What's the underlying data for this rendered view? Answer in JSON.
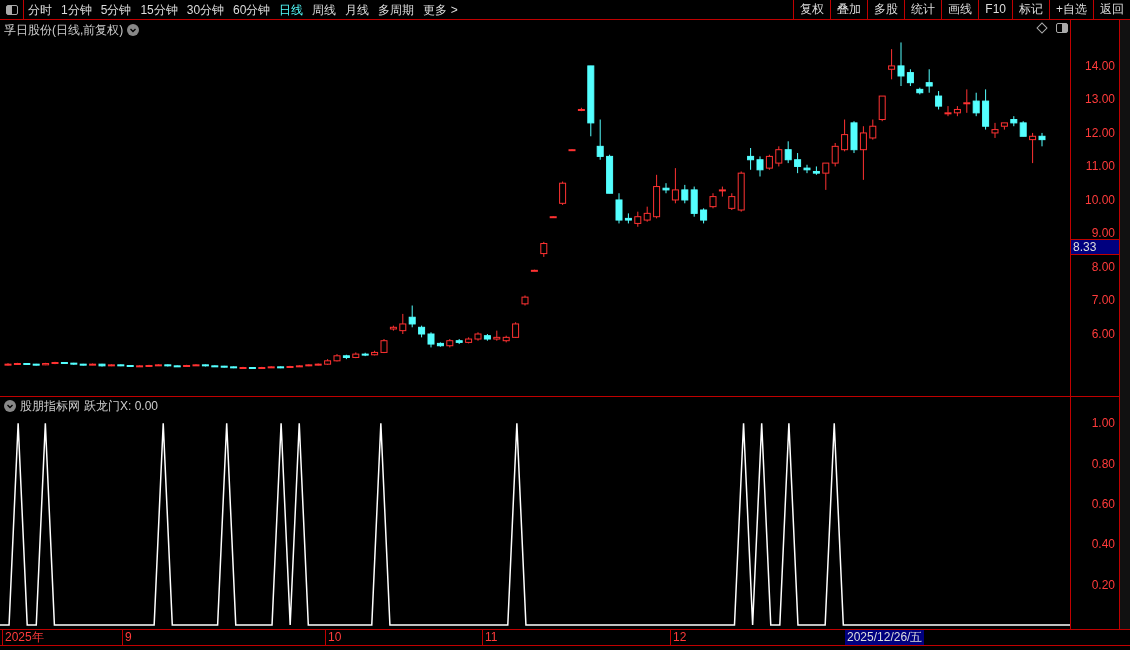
{
  "toolbar": {
    "periods": [
      {
        "label": "分时",
        "selected": false
      },
      {
        "label": "1分钟",
        "selected": false
      },
      {
        "label": "5分钟",
        "selected": false
      },
      {
        "label": "15分钟",
        "selected": false
      },
      {
        "label": "30分钟",
        "selected": false
      },
      {
        "label": "60分钟",
        "selected": false
      },
      {
        "label": "日线",
        "selected": true
      },
      {
        "label": "周线",
        "selected": false
      },
      {
        "label": "月线",
        "selected": false
      },
      {
        "label": "多周期",
        "selected": false
      },
      {
        "label": "更多 >",
        "selected": false
      }
    ],
    "actions": [
      "复权",
      "叠加",
      "多股",
      "统计",
      "画线",
      "F10",
      "标记",
      "+自选",
      "返回"
    ]
  },
  "main_chart": {
    "title": "孚日股份(日线,前复权)",
    "current_price": "8.33",
    "chart_data": {
      "type": "candlestick",
      "ylim": [
        4.15,
        15.37
      ],
      "yticks": [
        {
          "value": 14,
          "label": "14.00"
        },
        {
          "value": 13,
          "label": "13.00"
        },
        {
          "value": 12,
          "label": "12.00"
        },
        {
          "value": 11,
          "label": "11.00"
        },
        {
          "value": 10,
          "label": "10.00"
        },
        {
          "value": 9,
          "label": "9.00"
        },
        {
          "value": 8,
          "label": "8.00"
        },
        {
          "value": 7,
          "label": "7.00"
        },
        {
          "value": 6,
          "label": "6.00"
        }
      ],
      "ohlc": [
        [
          5.08,
          5.13,
          5.06,
          5.1
        ],
        [
          5.1,
          5.14,
          5.08,
          5.12
        ],
        [
          5.12,
          5.13,
          5.08,
          5.1
        ],
        [
          5.1,
          5.11,
          5.06,
          5.08
        ],
        [
          5.08,
          5.14,
          5.07,
          5.12
        ],
        [
          5.12,
          5.17,
          5.1,
          5.15
        ],
        [
          5.15,
          5.16,
          5.11,
          5.13
        ],
        [
          5.13,
          5.14,
          5.08,
          5.1
        ],
        [
          5.1,
          5.11,
          5.06,
          5.08
        ],
        [
          5.08,
          5.12,
          5.07,
          5.1
        ],
        [
          5.1,
          5.11,
          5.03,
          5.05
        ],
        [
          5.05,
          5.1,
          5.04,
          5.08
        ],
        [
          5.08,
          5.09,
          5.04,
          5.06
        ],
        [
          5.06,
          5.07,
          5.02,
          5.04
        ],
        [
          5.04,
          5.07,
          5.03,
          5.05
        ],
        [
          5.05,
          5.08,
          5.04,
          5.06
        ],
        [
          5.06,
          5.1,
          5.05,
          5.08
        ],
        [
          5.08,
          5.09,
          5.03,
          5.05
        ],
        [
          5.05,
          5.06,
          5.02,
          5.04
        ],
        [
          5.04,
          5.08,
          5.03,
          5.06
        ],
        [
          5.06,
          5.1,
          5.05,
          5.08
        ],
        [
          5.08,
          5.09,
          5.03,
          5.05
        ],
        [
          5.05,
          5.06,
          5.02,
          5.04
        ],
        [
          5.04,
          5.05,
          5.0,
          5.02
        ],
        [
          5.02,
          5.03,
          4.98,
          5.0
        ],
        [
          5.0,
          5.02,
          4.98,
          5.0
        ],
        [
          5.0,
          5.01,
          4.96,
          4.98
        ],
        [
          4.98,
          5.02,
          4.97,
          5.0
        ],
        [
          5.0,
          5.04,
          4.99,
          5.02
        ],
        [
          5.02,
          5.03,
          4.98,
          5.0
        ],
        [
          5.0,
          5.05,
          4.99,
          5.03
        ],
        [
          5.03,
          5.07,
          5.02,
          5.05
        ],
        [
          5.05,
          5.1,
          5.04,
          5.08
        ],
        [
          5.08,
          5.12,
          5.06,
          5.1
        ],
        [
          5.1,
          5.25,
          5.08,
          5.2
        ],
        [
          5.2,
          5.4,
          5.18,
          5.35
        ],
        [
          5.35,
          5.38,
          5.25,
          5.3
        ],
        [
          5.3,
          5.45,
          5.28,
          5.4
        ],
        [
          5.4,
          5.44,
          5.34,
          5.38
        ],
        [
          5.38,
          5.5,
          5.36,
          5.45
        ],
        [
          5.45,
          5.85,
          5.43,
          5.8
        ],
        [
          6.15,
          6.25,
          6.1,
          6.2
        ],
        [
          6.1,
          6.6,
          6.0,
          6.3
        ],
        [
          6.5,
          6.85,
          6.2,
          6.3
        ],
        [
          6.2,
          6.25,
          5.9,
          6.0
        ],
        [
          6.0,
          6.05,
          5.6,
          5.7
        ],
        [
          5.72,
          5.75,
          5.62,
          5.65
        ],
        [
          5.65,
          5.85,
          5.6,
          5.8
        ],
        [
          5.8,
          5.85,
          5.7,
          5.75
        ],
        [
          5.75,
          5.9,
          5.72,
          5.85
        ],
        [
          5.85,
          6.05,
          5.8,
          6.0
        ],
        [
          5.95,
          6.0,
          5.8,
          5.85
        ],
        [
          5.85,
          6.1,
          5.8,
          5.9
        ],
        [
          5.8,
          5.95,
          5.75,
          5.9
        ],
        [
          5.9,
          6.35,
          5.88,
          6.3
        ],
        [
          6.9,
          7.15,
          6.85,
          7.1
        ],
        [
          7.9,
          7.92,
          7.88,
          7.9
        ],
        [
          8.4,
          8.75,
          8.3,
          8.7
        ],
        [
          9.5,
          9.52,
          9.48,
          9.5
        ],
        [
          9.9,
          10.55,
          9.85,
          10.5
        ],
        [
          11.5,
          11.52,
          11.48,
          11.5
        ],
        [
          12.7,
          12.75,
          12.65,
          12.7
        ],
        [
          14.0,
          14.0,
          11.9,
          12.3
        ],
        [
          11.6,
          12.4,
          11.2,
          11.3
        ],
        [
          11.3,
          11.35,
          10.2,
          10.2
        ],
        [
          10.0,
          10.2,
          9.3,
          9.4
        ],
        [
          9.45,
          9.6,
          9.3,
          9.4
        ],
        [
          9.3,
          9.65,
          9.2,
          9.5
        ],
        [
          9.4,
          9.8,
          9.35,
          9.6
        ],
        [
          9.5,
          10.75,
          9.45,
          10.4
        ],
        [
          10.35,
          10.5,
          10.2,
          10.3
        ],
        [
          10.0,
          10.95,
          9.9,
          10.3
        ],
        [
          10.3,
          10.45,
          9.9,
          10.0
        ],
        [
          10.3,
          10.4,
          9.5,
          9.6
        ],
        [
          9.7,
          9.75,
          9.3,
          9.4
        ],
        [
          9.8,
          10.2,
          9.75,
          10.1
        ],
        [
          10.3,
          10.4,
          10.1,
          10.3
        ],
        [
          9.75,
          10.2,
          9.7,
          10.1
        ],
        [
          9.7,
          10.85,
          9.65,
          10.8
        ],
        [
          11.3,
          11.55,
          10.9,
          11.2
        ],
        [
          11.2,
          11.3,
          10.7,
          10.9
        ],
        [
          10.95,
          11.35,
          10.9,
          11.3
        ],
        [
          11.1,
          11.6,
          11.0,
          11.5
        ],
        [
          11.5,
          11.75,
          11.1,
          11.2
        ],
        [
          11.2,
          11.4,
          10.8,
          11.0
        ],
        [
          10.95,
          11.05,
          10.8,
          10.9
        ],
        [
          10.85,
          11.0,
          10.75,
          10.8
        ],
        [
          10.8,
          11.1,
          10.3,
          11.1
        ],
        [
          11.1,
          11.7,
          11.0,
          11.6
        ],
        [
          11.5,
          12.4,
          11.45,
          11.95
        ],
        [
          12.3,
          12.35,
          11.4,
          11.5
        ],
        [
          11.5,
          12.2,
          10.6,
          12.0
        ],
        [
          11.85,
          12.4,
          11.8,
          12.2
        ],
        [
          12.4,
          13.1,
          12.35,
          13.1
        ],
        [
          13.9,
          14.5,
          13.6,
          14.0
        ],
        [
          14.0,
          14.7,
          13.4,
          13.7
        ],
        [
          13.8,
          13.9,
          13.4,
          13.5
        ],
        [
          13.3,
          13.35,
          13.15,
          13.2
        ],
        [
          13.5,
          13.9,
          13.2,
          13.4
        ],
        [
          13.1,
          13.25,
          12.7,
          12.8
        ],
        [
          12.6,
          12.8,
          12.5,
          12.6
        ],
        [
          12.6,
          12.8,
          12.5,
          12.7
        ],
        [
          12.9,
          13.3,
          12.6,
          12.9
        ],
        [
          12.95,
          13.2,
          12.5,
          12.6
        ],
        [
          12.95,
          13.3,
          12.1,
          12.2
        ],
        [
          12.0,
          12.3,
          11.85,
          12.1
        ],
        [
          12.2,
          12.3,
          12.1,
          12.3
        ],
        [
          12.4,
          12.5,
          12.2,
          12.3
        ],
        [
          12.3,
          12.35,
          11.9,
          11.9
        ],
        [
          11.8,
          12.0,
          11.1,
          11.9
        ],
        [
          11.9,
          12.0,
          11.6,
          11.8
        ]
      ]
    }
  },
  "indicator": {
    "source": "股朋指标网",
    "reading": ": 0.00",
    "chart_data": {
      "type": "line",
      "ylim": [
        -0.02,
        1.13
      ],
      "categories": [
        null,
        null,
        null,
        null,
        null,
        null,
        null,
        null,
        null,
        null,
        null,
        null,
        null,
        null,
        null,
        null,
        null,
        null,
        null,
        null,
        null,
        null,
        null,
        null,
        null,
        null,
        null,
        null,
        null,
        null,
        null,
        null,
        null,
        null,
        null,
        null,
        null,
        null,
        null,
        null,
        null,
        null,
        null,
        null,
        null,
        null,
        null,
        null,
        null,
        null,
        null,
        null,
        null,
        null,
        null,
        null,
        null,
        null,
        null,
        null,
        null,
        null,
        null,
        null,
        null,
        null,
        null,
        null,
        null,
        null,
        null,
        null,
        null,
        null,
        null,
        null,
        null,
        null,
        null,
        null,
        null,
        null,
        null,
        null,
        null,
        null,
        null,
        null,
        null,
        null,
        null,
        null,
        null,
        null,
        null,
        null,
        null,
        null,
        null,
        null,
        null,
        null,
        null,
        null,
        null,
        null,
        null,
        null,
        null,
        null,
        null,
        null,
        null,
        null,
        null,
        null,
        null,
        null,
        null
      ],
      "yticks": [
        {
          "value": 0.2,
          "label": "0.20"
        },
        {
          "value": 0.4,
          "label": "0.40"
        },
        {
          "value": 0.6,
          "label": "0.60"
        },
        {
          "value": 0.8,
          "label": "0.80"
        },
        {
          "value": 1,
          "label": "1.00"
        }
      ],
      "series": [
        {
          "name": "跃龙门X",
          "color": "#ffffff",
          "values": [
            0,
            0,
            1,
            0,
            0,
            1,
            0,
            0,
            0,
            0,
            0,
            0,
            0,
            0,
            0,
            0,
            0,
            0,
            1,
            0,
            0,
            0,
            0,
            0,
            0,
            1,
            0,
            0,
            0,
            0,
            0,
            1,
            0,
            1,
            0,
            0,
            0,
            0,
            0,
            0,
            0,
            0,
            1,
            0,
            0,
            0,
            0,
            0,
            0,
            0,
            0,
            0,
            0,
            0,
            0,
            0,
            0,
            1,
            0,
            0,
            0,
            0,
            0,
            0,
            0,
            0,
            0,
            0,
            0,
            0,
            0,
            0,
            0,
            0,
            0,
            0,
            0,
            0,
            0,
            0,
            0,
            0,
            1,
            0,
            1,
            0,
            0,
            1,
            0,
            0,
            0,
            0,
            1,
            0,
            0,
            0,
            0,
            0,
            0,
            0,
            0,
            0,
            0,
            0,
            0,
            0,
            0,
            0,
            0,
            0,
            0,
            0,
            0,
            0,
            0,
            0,
            0,
            0,
            0
          ]
        }
      ]
    }
  },
  "date_axis": {
    "labels": [
      "2025年",
      "9",
      "10",
      "11",
      "12"
    ],
    "cursor_date": "2025/12/26/五"
  }
}
